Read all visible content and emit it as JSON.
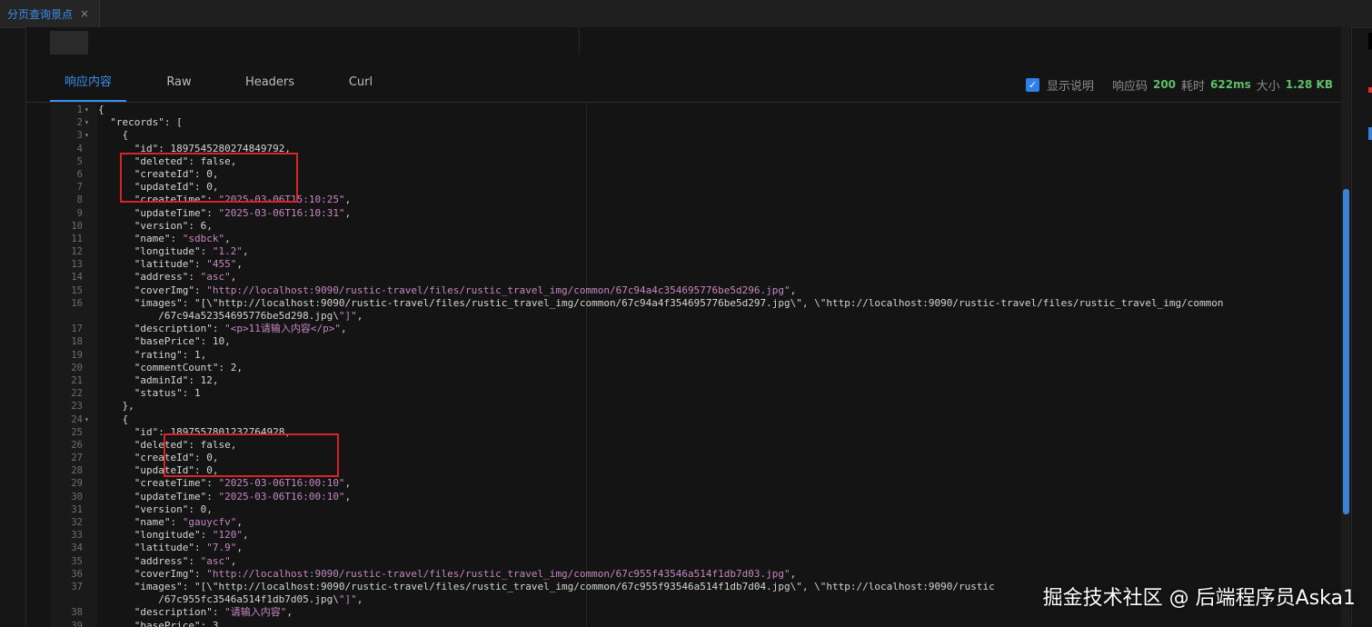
{
  "tab": {
    "title": "分页查询景点",
    "close": "×"
  },
  "response_tabs": [
    {
      "label": "响应内容",
      "active": true
    },
    {
      "label": "Raw",
      "active": false
    },
    {
      "label": "Headers",
      "active": false
    },
    {
      "label": "Curl",
      "active": false
    }
  ],
  "meta": {
    "checkbox_checked": true,
    "show_desc_label": "显示说明",
    "code_label": "响应码",
    "code_value": "200",
    "time_label": "耗时",
    "time_value": "622ms",
    "size_label": "大小",
    "size_value": "1.28 KB"
  },
  "colors": {
    "accent": "#3b8eea",
    "green": "#5fbf6a",
    "key": "#d4d4d4",
    "string": "#c586c0",
    "highlight": "#d9232a"
  },
  "code_lines": [
    {
      "n": "1",
      "fold": true,
      "t": "{"
    },
    {
      "n": "2",
      "fold": true,
      "t": "  \"records\": ["
    },
    {
      "n": "3",
      "fold": true,
      "t": "    {"
    },
    {
      "n": "4",
      "fold": false,
      "t": "      \"id\": 1897545280274849792,"
    },
    {
      "n": "5",
      "fold": false,
      "t": "      \"deleted\": false,"
    },
    {
      "n": "6",
      "fold": false,
      "t": "      \"createId\": 0,"
    },
    {
      "n": "7",
      "fold": false,
      "t": "      \"updateId\": 0,"
    },
    {
      "n": "8",
      "fold": false,
      "t": "      \"createTime\": \"2025-03-06T15:10:25\","
    },
    {
      "n": "9",
      "fold": false,
      "t": "      \"updateTime\": \"2025-03-06T16:10:31\","
    },
    {
      "n": "10",
      "fold": false,
      "t": "      \"version\": 6,"
    },
    {
      "n": "11",
      "fold": false,
      "t": "      \"name\": \"sdbck\","
    },
    {
      "n": "12",
      "fold": false,
      "t": "      \"longitude\": \"1.2\","
    },
    {
      "n": "13",
      "fold": false,
      "t": "      \"latitude\": \"455\","
    },
    {
      "n": "14",
      "fold": false,
      "t": "      \"address\": \"asc\","
    },
    {
      "n": "15",
      "fold": false,
      "t": "      \"coverImg\": \"http://localhost:9090/rustic-travel/files/rustic_travel_img/common/67c94a4c354695776be5d296.jpg\","
    },
    {
      "n": "16",
      "fold": false,
      "t": "      \"images\": \"[\\\"http://localhost:9090/rustic-travel/files/rustic_travel_img/common/67c94a4f354695776be5d297.jpg\\\", \\\"http://localhost:9090/rustic-travel/files/rustic_travel_img/common"
    },
    {
      "n": "",
      "fold": false,
      "t": "          /67c94a52354695776be5d298.jpg\\\"]\","
    },
    {
      "n": "17",
      "fold": false,
      "t": "      \"description\": \"<p>11请输入内容</p>\","
    },
    {
      "n": "18",
      "fold": false,
      "t": "      \"basePrice\": 10,"
    },
    {
      "n": "19",
      "fold": false,
      "t": "      \"rating\": 1,"
    },
    {
      "n": "20",
      "fold": false,
      "t": "      \"commentCount\": 2,"
    },
    {
      "n": "21",
      "fold": false,
      "t": "      \"adminId\": 12,"
    },
    {
      "n": "22",
      "fold": false,
      "t": "      \"status\": 1"
    },
    {
      "n": "23",
      "fold": false,
      "t": "    },"
    },
    {
      "n": "24",
      "fold": true,
      "t": "    {"
    },
    {
      "n": "25",
      "fold": false,
      "t": "      \"id\": 1897557801232764928,"
    },
    {
      "n": "26",
      "fold": false,
      "t": "      \"deleted\": false,"
    },
    {
      "n": "27",
      "fold": false,
      "t": "      \"createId\": 0,"
    },
    {
      "n": "28",
      "fold": false,
      "t": "      \"updateId\": 0,"
    },
    {
      "n": "29",
      "fold": false,
      "t": "      \"createTime\": \"2025-03-06T16:00:10\","
    },
    {
      "n": "30",
      "fold": false,
      "t": "      \"updateTime\": \"2025-03-06T16:00:10\","
    },
    {
      "n": "31",
      "fold": false,
      "t": "      \"version\": 0,"
    },
    {
      "n": "32",
      "fold": false,
      "t": "      \"name\": \"gauycfv\","
    },
    {
      "n": "33",
      "fold": false,
      "t": "      \"longitude\": \"120\","
    },
    {
      "n": "34",
      "fold": false,
      "t": "      \"latitude\": \"7.9\","
    },
    {
      "n": "35",
      "fold": false,
      "t": "      \"address\": \"asc\","
    },
    {
      "n": "36",
      "fold": false,
      "t": "      \"coverImg\": \"http://localhost:9090/rustic-travel/files/rustic_travel_img/common/67c955f43546a514f1db7d03.jpg\","
    },
    {
      "n": "37",
      "fold": false,
      "t": "      \"images\": \"[\\\"http://localhost:9090/rustic-travel/files/rustic_travel_img/common/67c955f93546a514f1db7d04.jpg\\\", \\\"http://localhost:9090/rustic"
    },
    {
      "n": "",
      "fold": false,
      "t": "          /67c955fc3546a514f1db7d05.jpg\\\"]\","
    },
    {
      "n": "38",
      "fold": false,
      "t": "      \"description\": \"请输入内容\","
    },
    {
      "n": "39",
      "fold": false,
      "t": "      \"basePrice\": 3,"
    }
  ],
  "watermark": "掘金技术社区 @ 后端程序员Aska1"
}
